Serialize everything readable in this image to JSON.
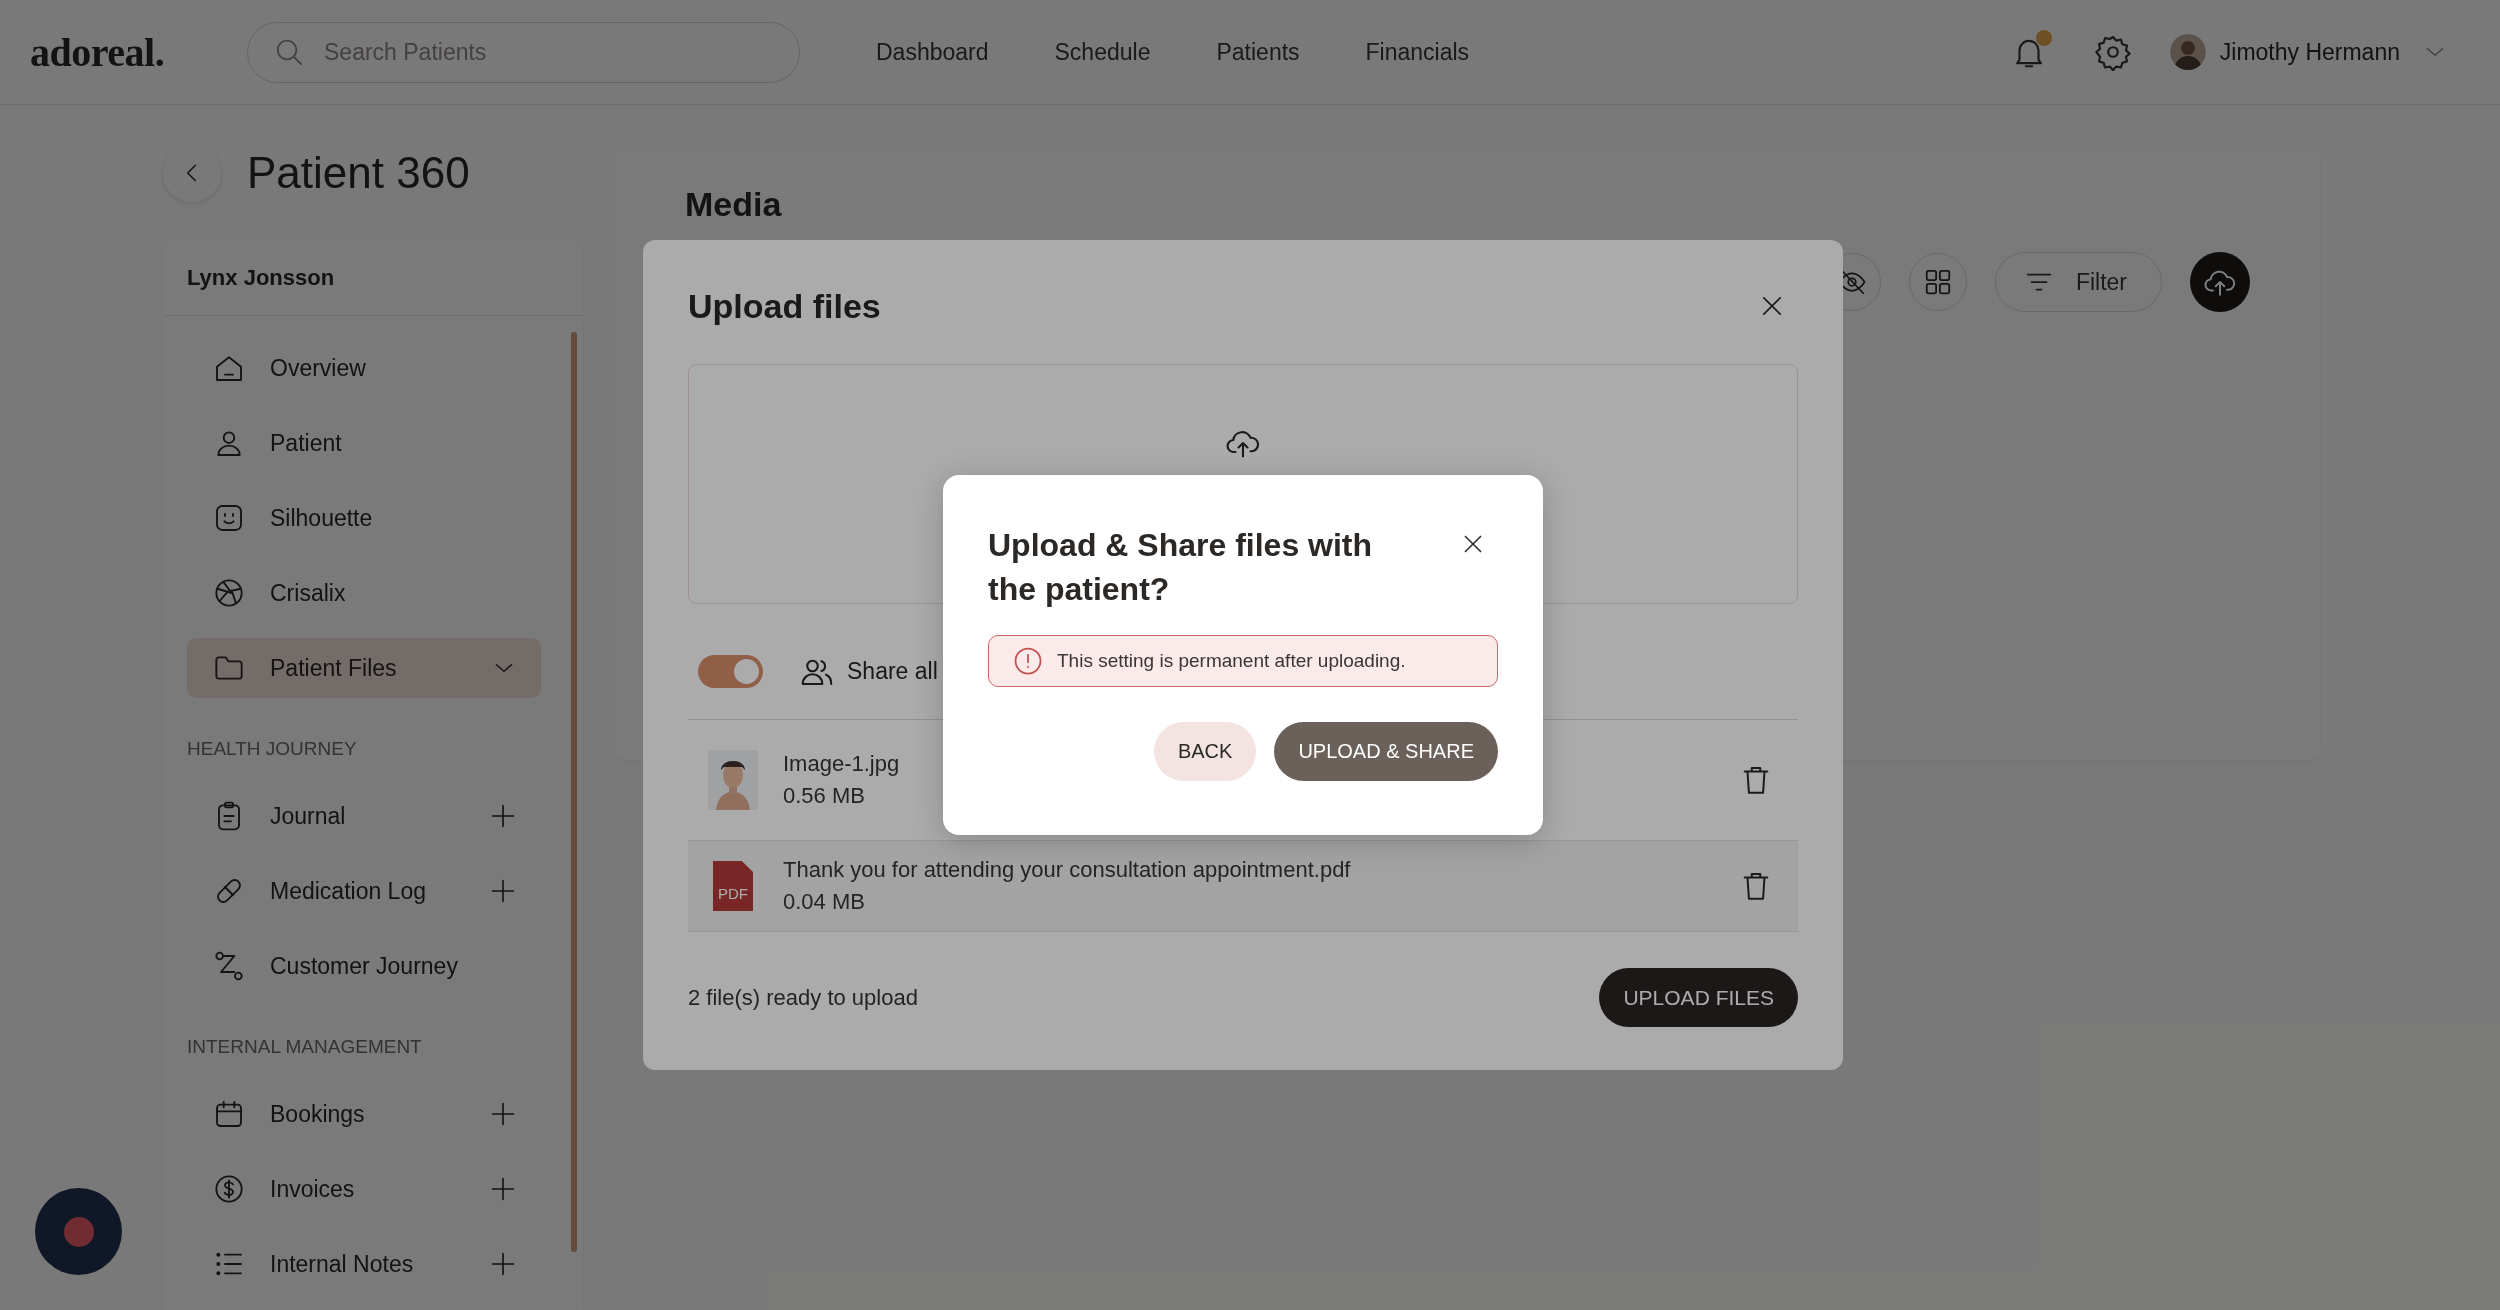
{
  "header": {
    "logo": "adoreal.",
    "search": {
      "placeholder": "Search Patients"
    },
    "nav": [
      {
        "label": "Dashboard",
        "selected": false
      },
      {
        "label": "Schedule",
        "selected": false
      },
      {
        "label": "Patients",
        "selected": false
      },
      {
        "label": "Financials",
        "selected": false
      }
    ],
    "notifications": {
      "unread": true
    },
    "user": {
      "name": "Jimothy Hermann"
    }
  },
  "page": {
    "title": "Patient 360"
  },
  "sidebar": {
    "patient_name": "Lynx Jonsson",
    "groups": [
      {
        "items": [
          {
            "label": "Overview",
            "kind": "link",
            "selected": false
          },
          {
            "label": "Patient",
            "kind": "link",
            "selected": false
          },
          {
            "label": "Silhouette",
            "kind": "link",
            "selected": false
          },
          {
            "label": "Crisalix",
            "kind": "link",
            "selected": false
          },
          {
            "label": "Patient Files",
            "kind": "dropdown",
            "selected": true
          }
        ]
      },
      {
        "heading": "HEALTH JOURNEY",
        "items": [
          {
            "label": "Journal",
            "kind": "add",
            "selected": false
          },
          {
            "label": "Medication Log",
            "kind": "add",
            "selected": false
          },
          {
            "label": "Customer Journey",
            "kind": "link",
            "selected": false
          }
        ]
      },
      {
        "heading": "INTERNAL MANAGEMENT",
        "items": [
          {
            "label": "Bookings",
            "kind": "add",
            "selected": false
          },
          {
            "label": "Invoices",
            "kind": "add",
            "selected": false
          },
          {
            "label": "Internal Notes",
            "kind": "add",
            "selected": false
          }
        ]
      }
    ]
  },
  "media": {
    "title": "Media",
    "filter_label": "Filter"
  },
  "upload": {
    "title": "Upload files",
    "share_all": {
      "label": "Share all",
      "on": true
    },
    "files": [
      {
        "name": "Image-1.jpg",
        "size": "0.56 MB"
      },
      {
        "name": "Thank you for attending your consultation appointment.pdf",
        "size": "0.04 MB",
        "kind": "pdf",
        "badge": "PDF"
      }
    ],
    "status": "2 file(s) ready to upload",
    "submit": "UPLOAD FILES"
  },
  "dialog": {
    "title": "Upload & Share files with the patient?",
    "warning": "This setting is permanent after uploading.",
    "buttons": [
      {
        "label": "BACK",
        "kind": "secondary"
      },
      {
        "label": "UPLOAD & SHARE",
        "kind": "primary"
      }
    ]
  }
}
